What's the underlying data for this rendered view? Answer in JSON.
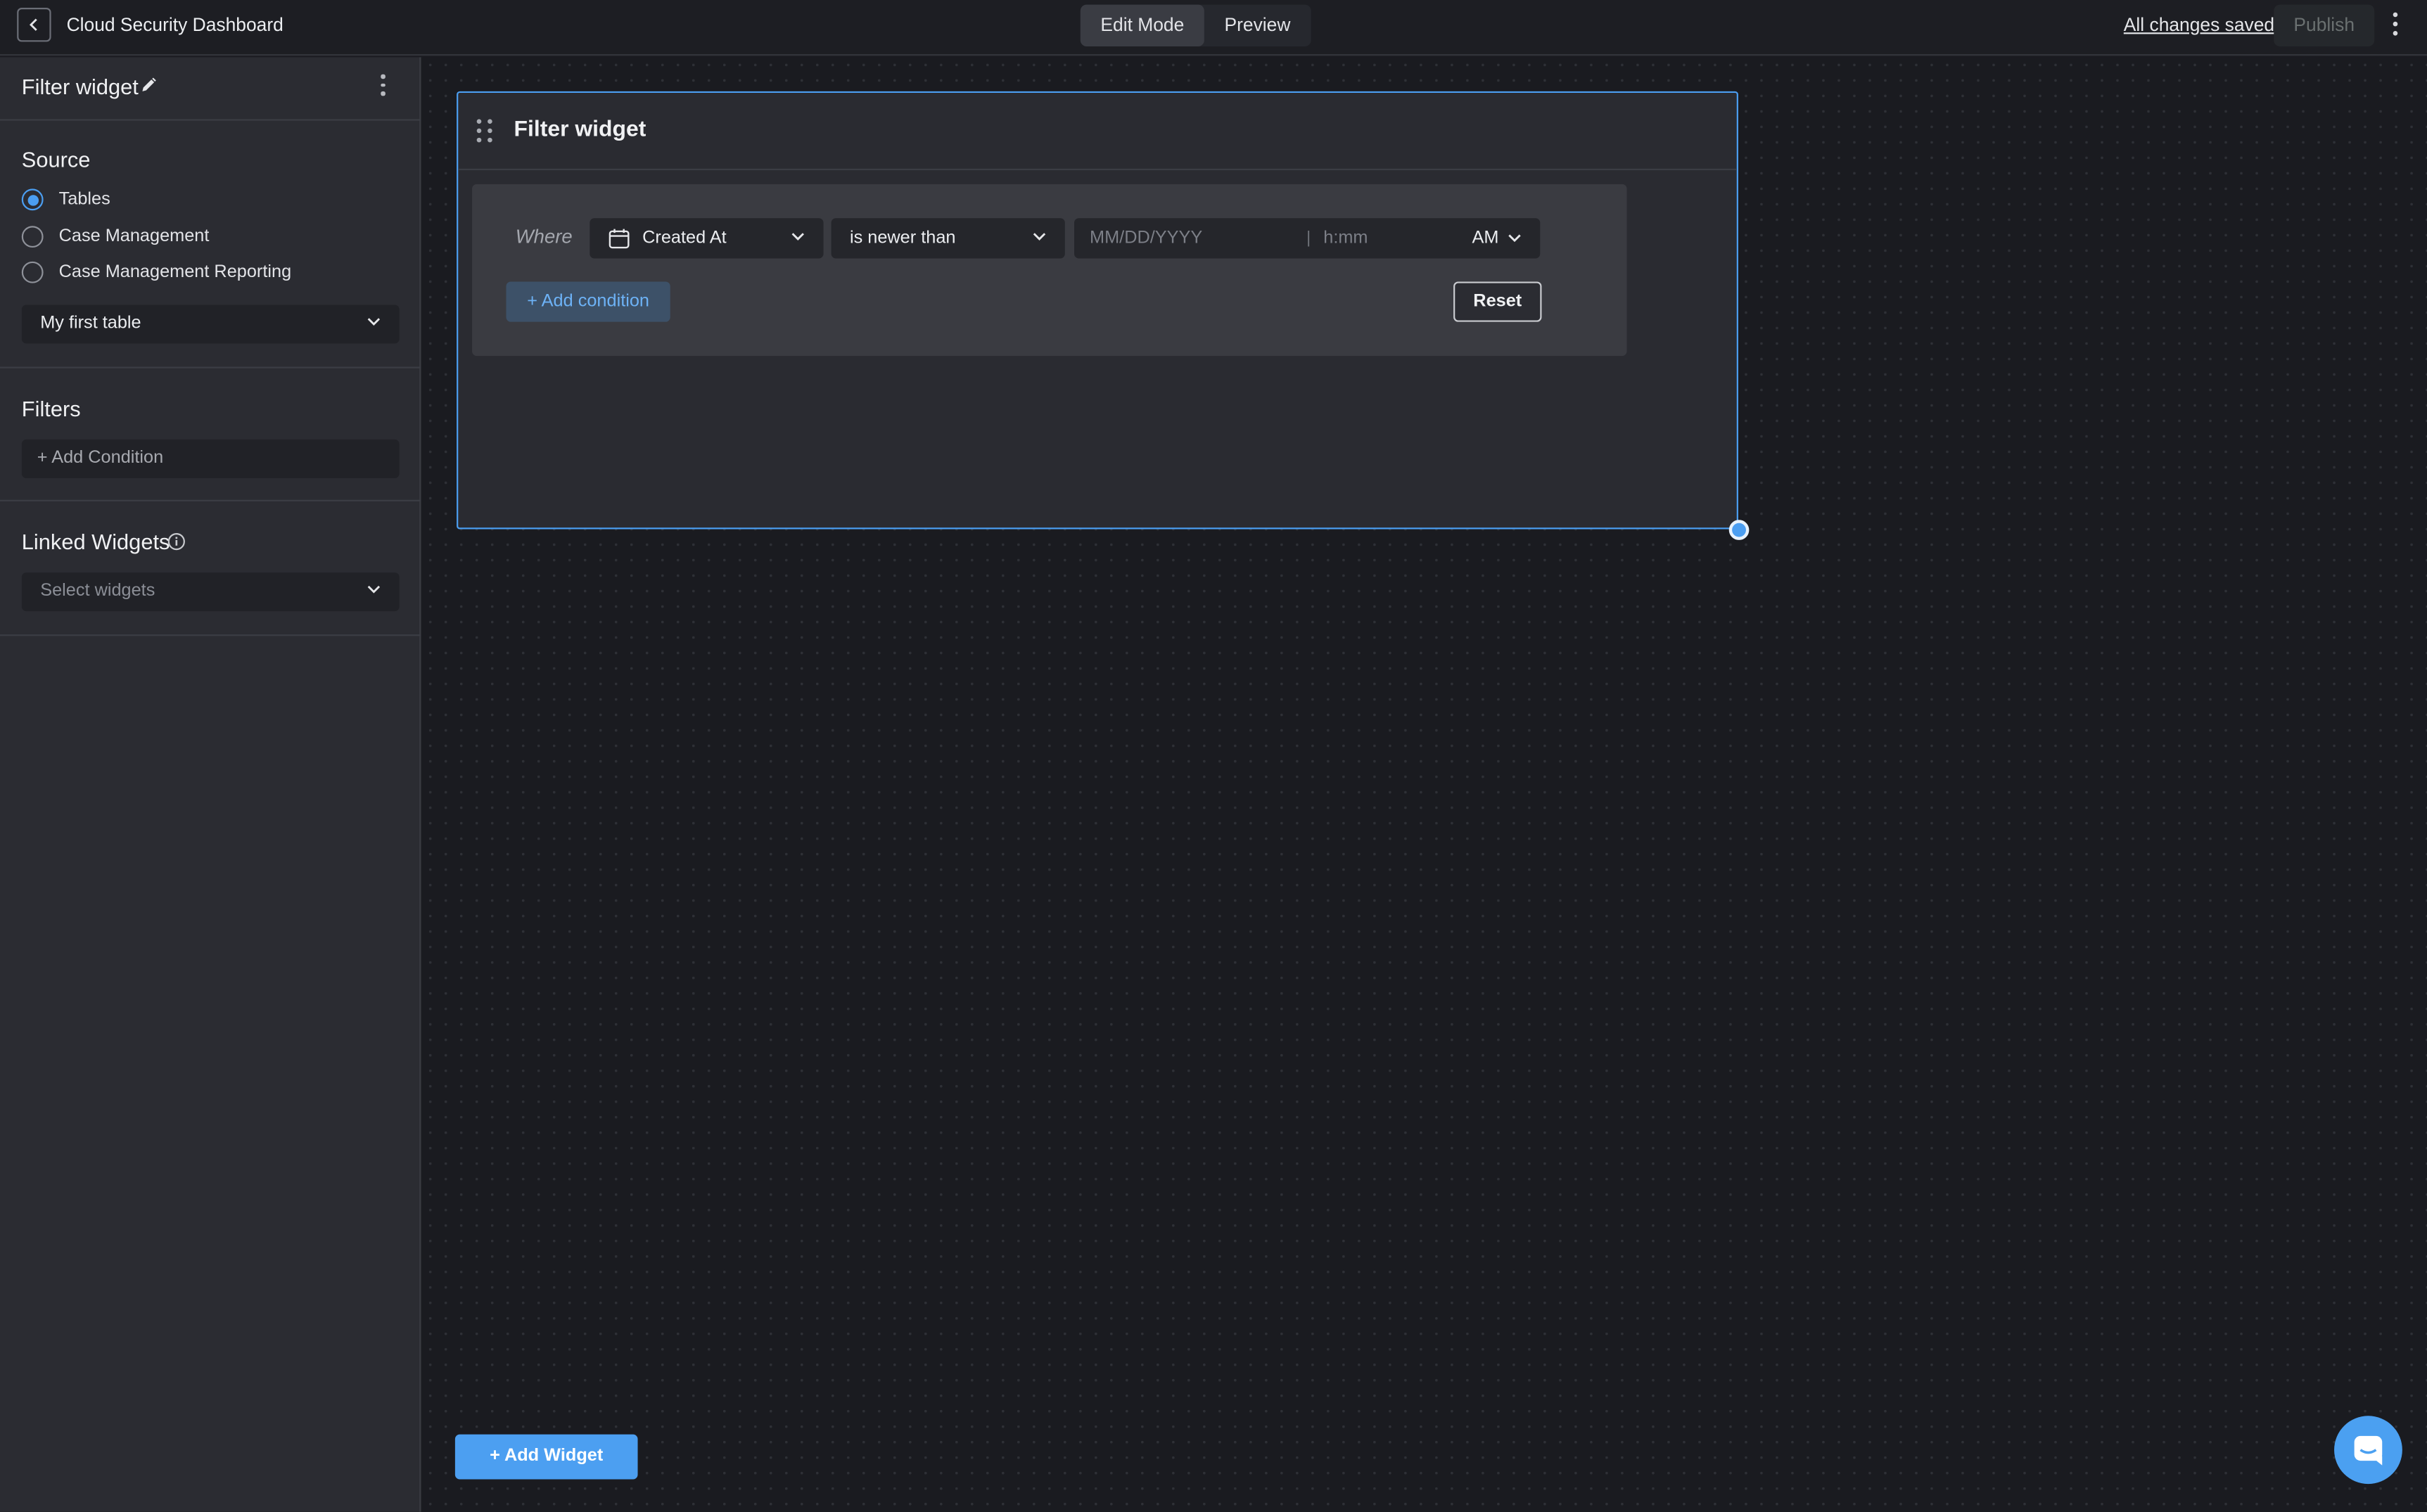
{
  "topbar": {
    "title": "Cloud Security Dashboard",
    "modes": [
      {
        "label": "Edit Mode",
        "active": true
      },
      {
        "label": "Preview",
        "active": false
      }
    ],
    "saved_status": "All changes saved",
    "publish_label": "Publish"
  },
  "sidebar": {
    "title": "Filter widget",
    "source": {
      "heading": "Source",
      "options": [
        {
          "label": "Tables",
          "checked": true
        },
        {
          "label": "Case Management",
          "checked": false
        },
        {
          "label": "Case Management Reporting",
          "checked": false
        }
      ],
      "table_select": "My first table"
    },
    "filters": {
      "heading": "Filters",
      "add_condition": "+ Add Condition"
    },
    "linked_widgets": {
      "heading": "Linked Widgets",
      "placeholder": "Select widgets"
    }
  },
  "widget": {
    "title": "Filter widget",
    "where_label": "Where",
    "field": "Created At",
    "operator": "is newer than",
    "date_placeholder": "MM/DD/YYYY",
    "separator": "|",
    "time_placeholder": "h:mm",
    "ampm": "AM",
    "add_condition_label": "+ Add condition",
    "reset_label": "Reset"
  },
  "canvas": {
    "add_widget_label": "+ Add Widget"
  },
  "colors": {
    "accent": "#4b9ef1",
    "background": "#1b1c21",
    "sidebar": "#2b2c32"
  }
}
